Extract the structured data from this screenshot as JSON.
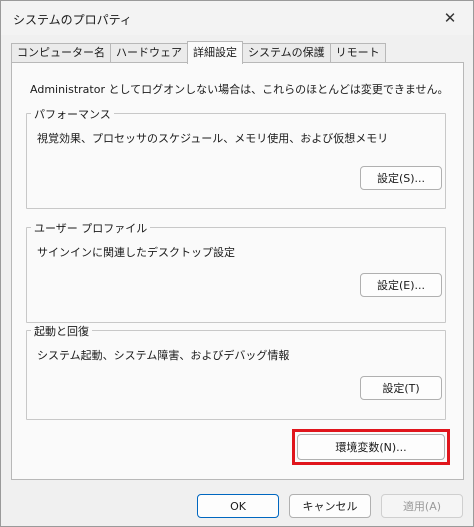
{
  "window": {
    "title": "システムのプロパティ",
    "close_glyph": "✕"
  },
  "tabs": [
    {
      "label": "コンピューター名",
      "active": false
    },
    {
      "label": "ハードウェア",
      "active": false
    },
    {
      "label": "詳細設定",
      "active": true
    },
    {
      "label": "システムの保護",
      "active": false
    },
    {
      "label": "リモート",
      "active": false
    }
  ],
  "panel": {
    "intro": "Administrator としてログオンしない場合は、これらのほとんどは変更できません。",
    "performance": {
      "legend": "パフォーマンス",
      "description": "視覚効果、プロセッサのスケジュール、メモリ使用、および仮想メモリ",
      "button": "設定(S)..."
    },
    "user_profile": {
      "legend": "ユーザー プロファイル",
      "description": "サインインに関連したデスクトップ設定",
      "button": "設定(E)..."
    },
    "startup_recovery": {
      "legend": "起動と回復",
      "description": "システム起動、システム障害、およびデバッグ情報",
      "button": "設定(T)"
    },
    "env_vars_button": "環境変数(N)...",
    "highlight_color": "#e0151c"
  },
  "footer": {
    "ok": "OK",
    "cancel": "キャンセル",
    "apply": "適用(A)"
  }
}
